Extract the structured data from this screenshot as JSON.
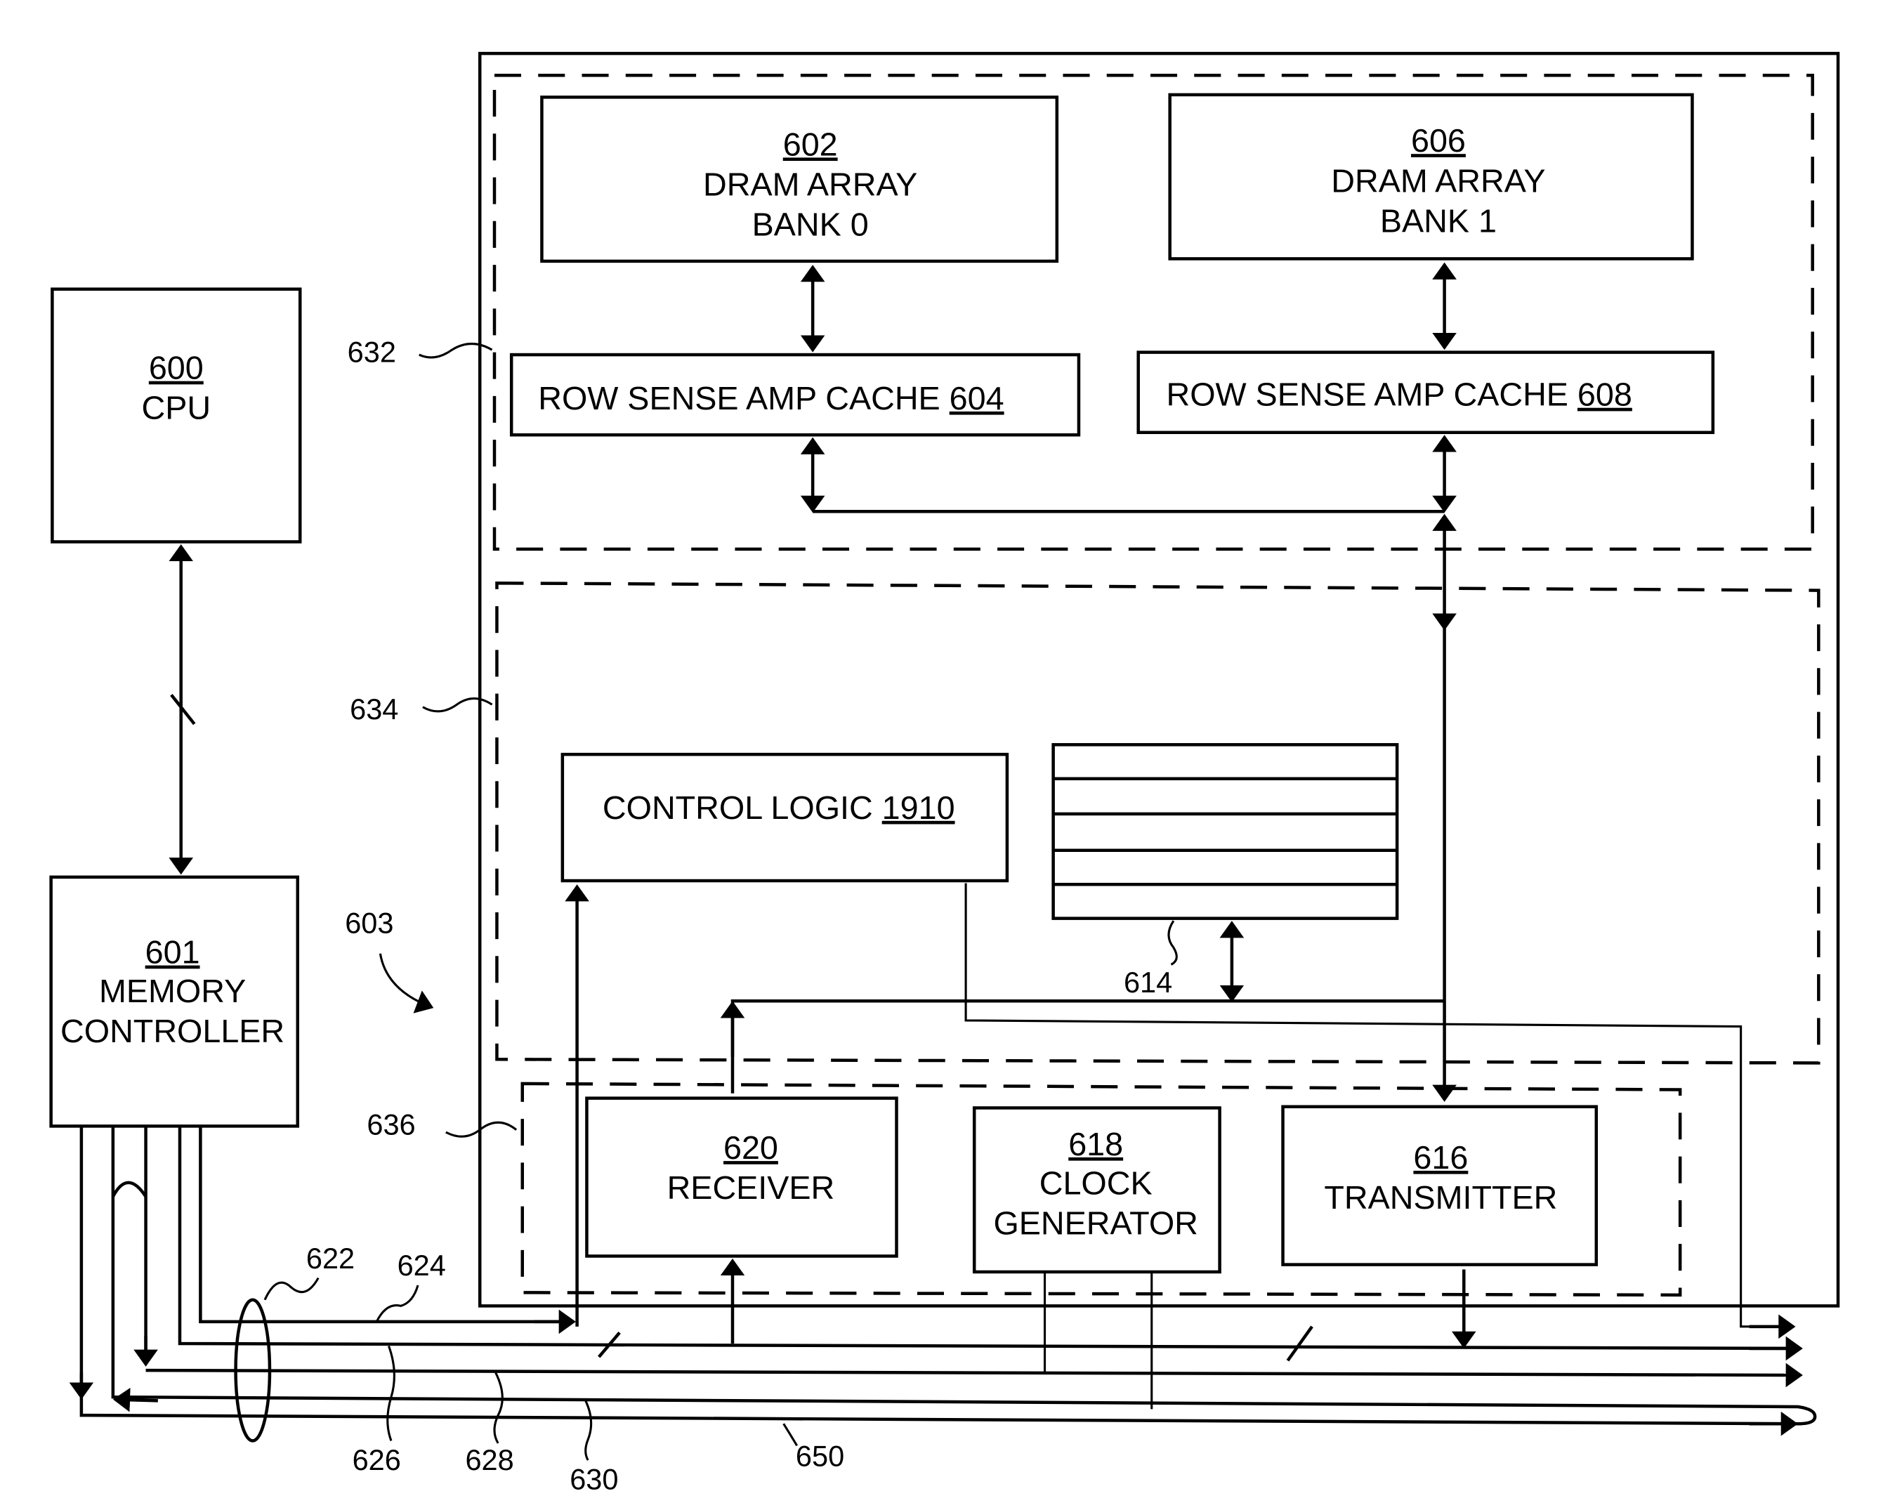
{
  "figure": {
    "system_ref": "603",
    "blocks": {
      "cpu": {
        "ref": "600",
        "name": "CPU"
      },
      "memory_controller": {
        "ref": "601",
        "name_line1": "MEMORY",
        "name_line2": "CONTROLLER"
      },
      "dram_bank0": {
        "ref": "602",
        "name_line1": "DRAM ARRAY",
        "name_line2": "BANK 0"
      },
      "dram_bank1": {
        "ref": "606",
        "name_line1": "DRAM ARRAY",
        "name_line2": "BANK 1"
      },
      "sense_amp0": {
        "name": "ROW SENSE AMP CACHE ",
        "ref": "604"
      },
      "sense_amp1": {
        "name": "ROW SENSE AMP CACHE ",
        "ref": "608"
      },
      "control_logic": {
        "name": "CONTROL LOGIC ",
        "ref": "1910"
      },
      "register": {
        "ref": "614"
      },
      "receiver": {
        "ref": "620",
        "name": "RECEIVER"
      },
      "clock_generator": {
        "ref": "618",
        "name_line1": "CLOCK",
        "name_line2": "GENERATOR"
      },
      "transmitter": {
        "ref": "616",
        "name": "TRANSMITTER"
      }
    },
    "region_refs": {
      "core": "632",
      "interface": "634",
      "io": "636"
    },
    "bus_refs": {
      "bus": "622",
      "line_624": "624",
      "line_626": "626",
      "line_628": "628",
      "line_630": "630",
      "line_650": "650"
    }
  }
}
